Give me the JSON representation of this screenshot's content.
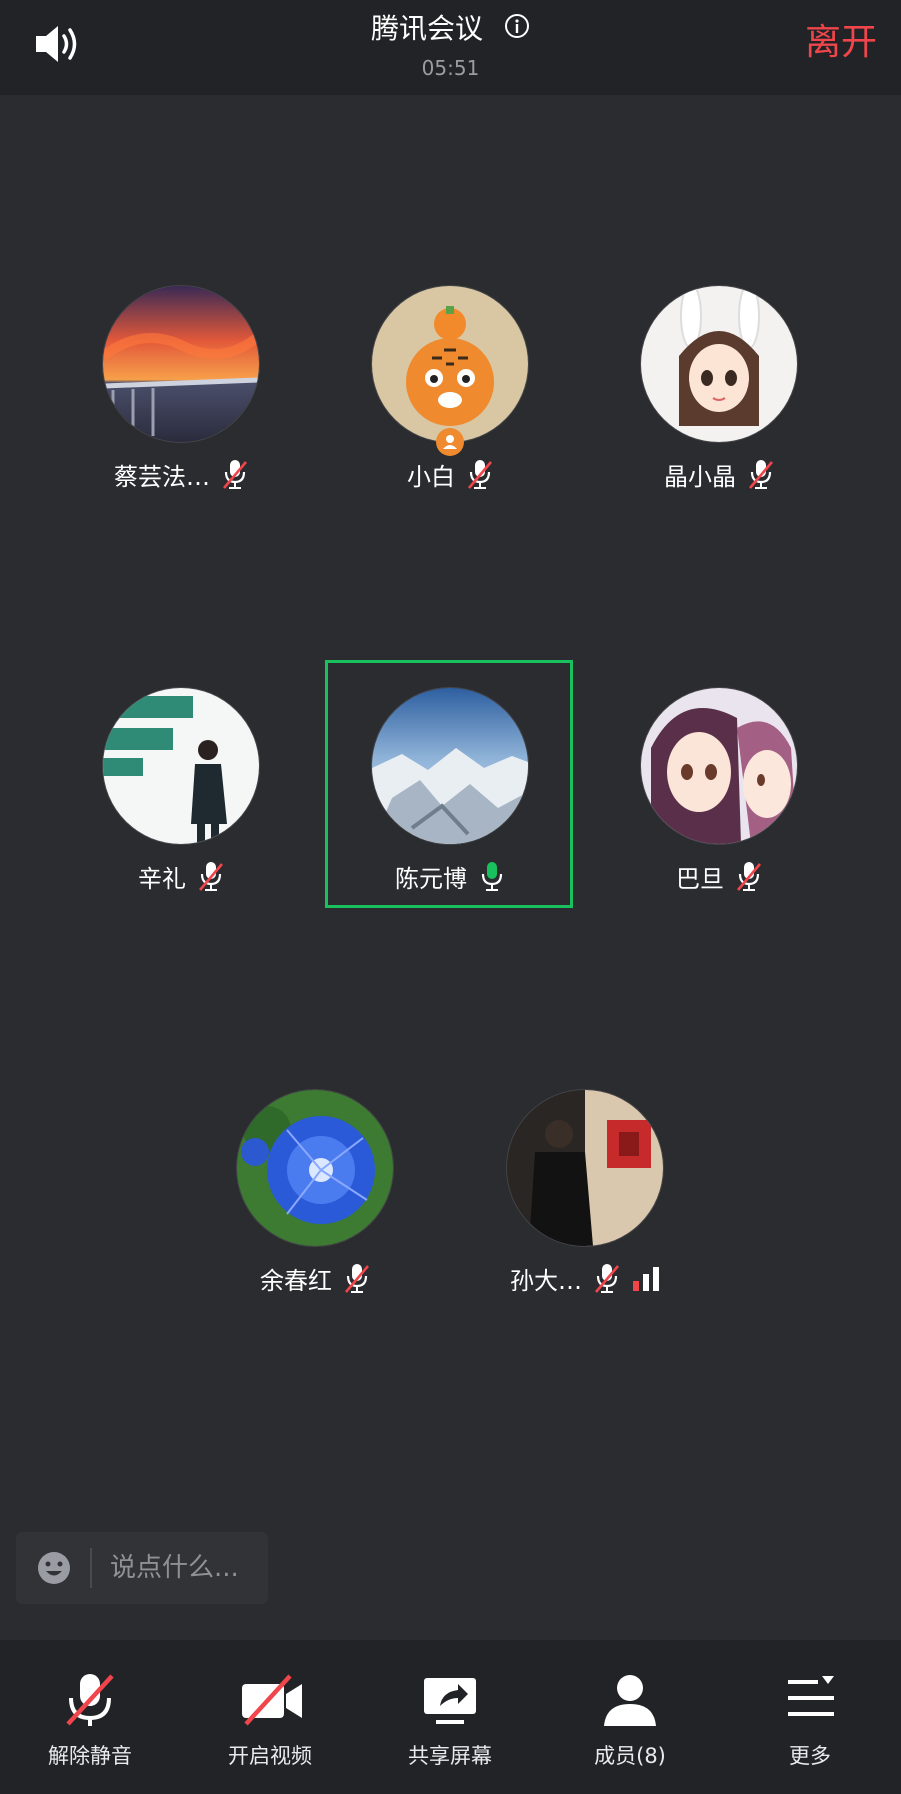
{
  "header": {
    "title": "腾讯会议",
    "timer": "05:51",
    "leave_label": "离开"
  },
  "participants": [
    {
      "name": "蔡芸法…",
      "mic": "muted",
      "avatar": "sunset-bridge-photo"
    },
    {
      "name": "小白",
      "mic": "muted",
      "avatar": "tiger-cartoon",
      "badge": "host-icon"
    },
    {
      "name": "晶小晶",
      "mic": "muted",
      "avatar": "anime-girl-bunny-ears"
    },
    {
      "name": "辛礼",
      "mic": "muted",
      "avatar": "speaker-on-stage-photo"
    },
    {
      "name": "陈元博",
      "mic": "speaking",
      "avatar": "mountain-aerial-photo",
      "active": true
    },
    {
      "name": "巴旦",
      "mic": "muted",
      "avatar": "anime-two-girls"
    },
    {
      "name": "余春红",
      "mic": "muted",
      "avatar": "blue-morning-glory-flower"
    },
    {
      "name": "孙大…",
      "mic": "muted",
      "avatar": "man-in-black-jacket-photo",
      "signal": "weak"
    }
  ],
  "chat": {
    "placeholder": "说点什么..."
  },
  "toolbar": {
    "unmute": "解除静音",
    "start_video": "开启视频",
    "share_screen": "共享屏幕",
    "members": "成员(8)",
    "more": "更多"
  },
  "colors": {
    "accent_red": "#f0464b",
    "speaking_green": "#19c05e",
    "background": "#2b2c30",
    "bar": "#222326"
  }
}
